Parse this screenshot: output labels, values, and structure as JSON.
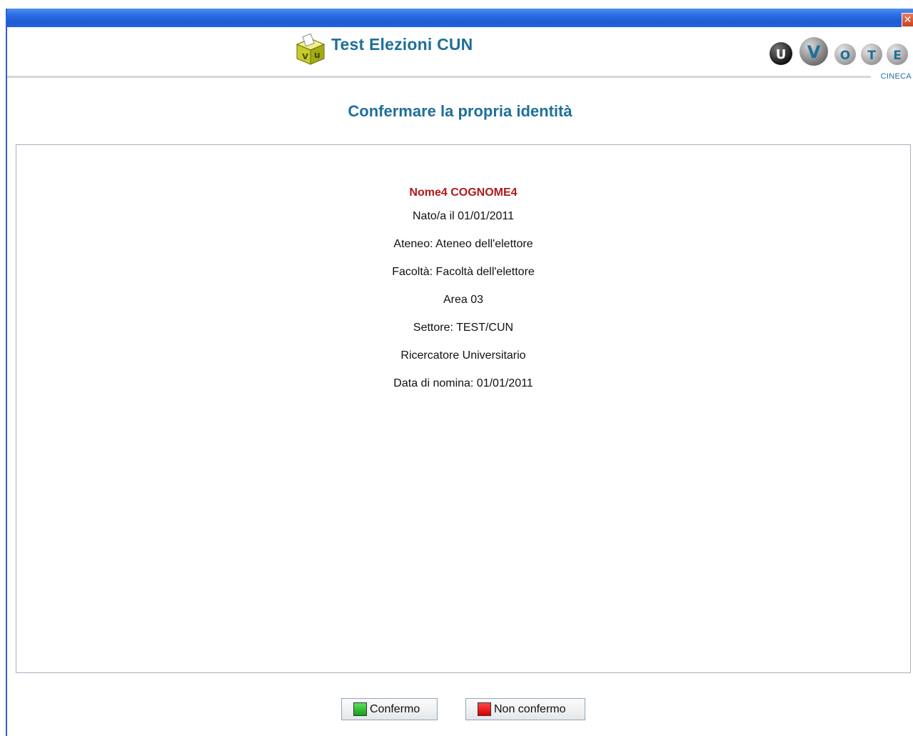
{
  "window": {
    "close_icon": "close-icon",
    "close_label": "✕"
  },
  "header": {
    "app_title": "Test Elezioni CUN",
    "logo_icon": "ballot-box-icon",
    "brand_letters": [
      "U",
      "V",
      "O",
      "T",
      "E"
    ],
    "brand_caption": "CINECA"
  },
  "page": {
    "heading": "Confermare la propria identità"
  },
  "identity": {
    "name": "Nome4 COGNOME4",
    "fields": [
      "Nato/a il 01/01/2011",
      "Ateneo: Ateneo dell'elettore",
      "Facoltà: Facoltà dell'elettore",
      "Area 03",
      "Settore: TEST/CUN",
      "Ricercatore Universitario",
      "Data di nomina: 01/01/2011"
    ]
  },
  "actions": {
    "confirm_label": "Confermo",
    "reject_label": "Non confermo"
  },
  "colors": {
    "accent": "#1f6f9a",
    "name_red": "#b2191b",
    "confirm_green": "#14a014",
    "reject_red": "#d50000"
  }
}
